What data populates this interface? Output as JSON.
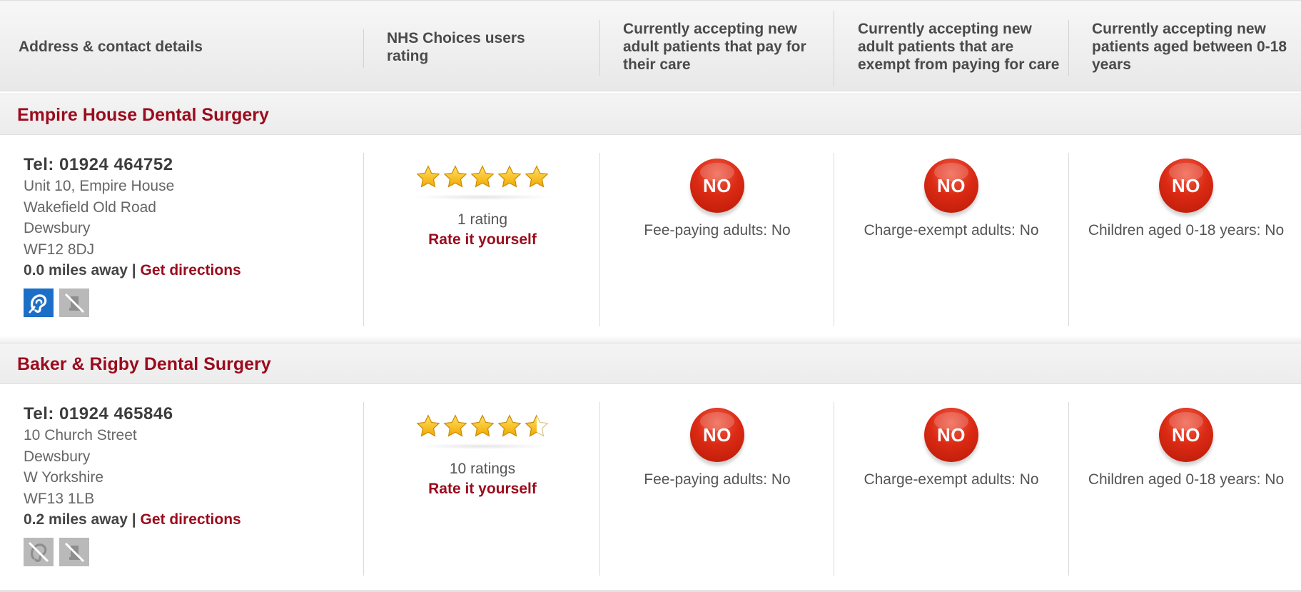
{
  "header": {
    "col_address": "Address & contact details",
    "col_rating": "NHS Choices users rating",
    "col_fee": "Currently accepting new adult patients that pay for their care",
    "col_exempt": "Currently accepting new adult patients that are exempt from paying for care",
    "col_children": "Currently accepting new patients aged between 0-18 years"
  },
  "practices": [
    {
      "name": "Empire House Dental Surgery",
      "tel": "Tel: 01924 464752",
      "address": [
        "Unit 10, Empire House",
        "Wakefield Old Road",
        "Dewsbury",
        "WF12 8DJ"
      ],
      "distance": "0.0 miles away",
      "separator": "|",
      "directions": "Get directions",
      "accessibility_icons": [
        "hearing-loop-icon",
        "wheelchair-unavailable-icon"
      ],
      "rating": {
        "stars": 5,
        "count_text": "1 rating",
        "rate_link": "Rate it yourself"
      },
      "fee": {
        "badge": "NO",
        "text": "Fee-paying adults: No"
      },
      "exempt": {
        "badge": "NO",
        "text": "Charge-exempt adults: No"
      },
      "children": {
        "badge": "NO",
        "text": "Children aged 0-18 years: No"
      }
    },
    {
      "name": "Baker & Rigby Dental Surgery",
      "tel": "Tel: 01924 465846",
      "address": [
        "10 Church Street",
        "Dewsbury",
        "W Yorkshire",
        "WF13 1LB"
      ],
      "distance": "0.2 miles away",
      "separator": "|",
      "directions": "Get directions",
      "accessibility_icons": [
        "hearing-loop-unavailable-icon",
        "wheelchair-unavailable-icon"
      ],
      "rating": {
        "stars": 4.5,
        "count_text": "10 ratings",
        "rate_link": "Rate it yourself"
      },
      "fee": {
        "badge": "NO",
        "text": "Fee-paying adults: No"
      },
      "exempt": {
        "badge": "NO",
        "text": "Charge-exempt adults: No"
      },
      "children": {
        "badge": "NO",
        "text": "Children aged 0-18 years: No"
      }
    }
  ],
  "colors": {
    "brand_red": "#9a0b1d",
    "badge_red": "#db2a14",
    "accessible_blue": "#1c6fc7",
    "unavailable_grey": "#b9b9b9",
    "star_gold": "#f5b800"
  }
}
